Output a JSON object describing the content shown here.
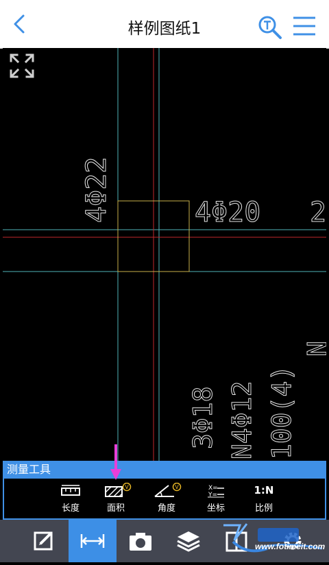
{
  "header": {
    "title": "样例图纸1",
    "back_icon": "chevron-left-icon",
    "search_icon": "text-search-icon",
    "menu_icon": "hamburger-menu-icon",
    "accent_color": "#3f90e6"
  },
  "drawing": {
    "labels": {
      "rebar_left": "4Φ22",
      "rebar_right": "4Φ20",
      "partial_right": "2",
      "rebar_bottom1": "3Φ18",
      "rebar_bottom2": "N4Φ12",
      "rebar_bottom3": "100(4)",
      "partial_edge": "N"
    }
  },
  "measure_tools": {
    "header_label": "测量工具",
    "tools": [
      {
        "label": "长度",
        "icon": "ruler-icon",
        "badge": ""
      },
      {
        "label": "面积",
        "icon": "area-hatch-icon",
        "badge": "V"
      },
      {
        "label": "角度",
        "icon": "angle-icon",
        "badge": "V"
      },
      {
        "label": "坐标",
        "icon": "coordinate-icon",
        "badge": ""
      },
      {
        "label": "比例",
        "icon": "scale-icon",
        "badge": "",
        "icon_text": "1:N"
      }
    ]
  },
  "bottom_bar": {
    "items": [
      {
        "icon": "edit-icon",
        "active": false
      },
      {
        "icon": "measure-icon",
        "active": true
      },
      {
        "icon": "camera-icon",
        "active": false
      },
      {
        "icon": "layers-icon",
        "active": false
      },
      {
        "icon": "columns-icon",
        "active": false
      },
      {
        "icon": "gear-icon",
        "active": false
      }
    ]
  },
  "watermark": {
    "text": "www.fotimeit.com"
  }
}
